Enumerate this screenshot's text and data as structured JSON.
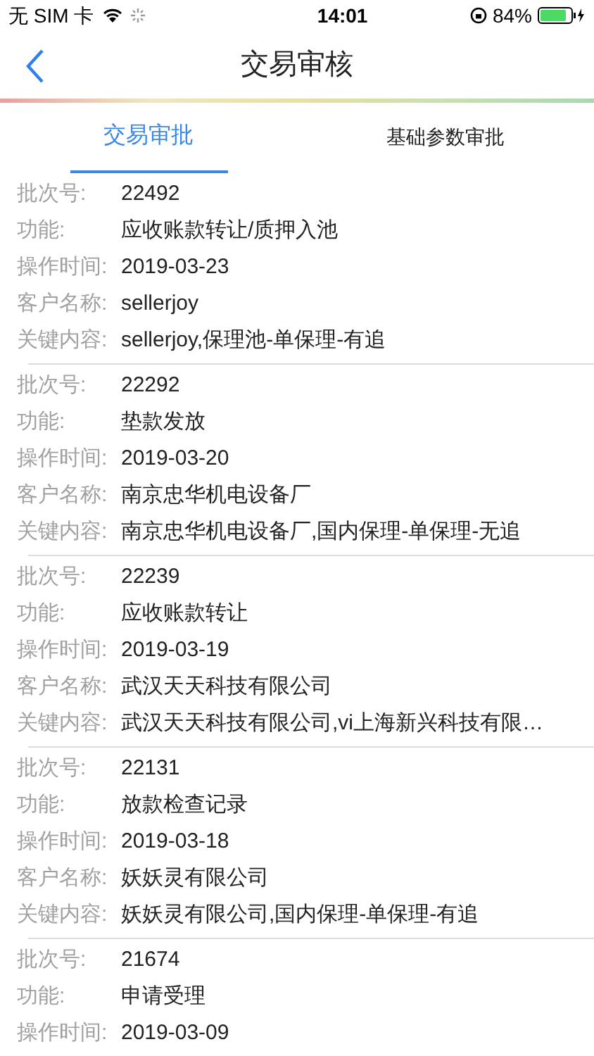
{
  "status_bar": {
    "carrier": "无 SIM 卡",
    "time": "14:01",
    "battery": "84%"
  },
  "nav": {
    "title": "交易审核"
  },
  "tabs": [
    {
      "label": "交易审批",
      "selected": true
    },
    {
      "label": "基础参数审批",
      "selected": false
    }
  ],
  "records": [
    {
      "fields": [
        {
          "label": "批次号:",
          "value": "22492"
        },
        {
          "label": "功能:",
          "value": "应收账款转让/质押入池"
        },
        {
          "label": "操作时间:",
          "value": "2019-03-23"
        },
        {
          "label": "客户名称:",
          "value": "sellerjoy"
        },
        {
          "label": "关键内容:",
          "value": "sellerjoy,保理池-单保理-有追"
        }
      ]
    },
    {
      "fields": [
        {
          "label": "批次号:",
          "value": "22292"
        },
        {
          "label": "功能:",
          "value": "垫款发放"
        },
        {
          "label": "操作时间:",
          "value": "2019-03-20"
        },
        {
          "label": "客户名称:",
          "value": "南京忠华机电设备厂"
        },
        {
          "label": "关键内容:",
          "value": "南京忠华机电设备厂,国内保理-单保理-无追"
        }
      ]
    },
    {
      "fields": [
        {
          "label": "批次号:",
          "value": "22239"
        },
        {
          "label": "功能:",
          "value": "应收账款转让"
        },
        {
          "label": "操作时间:",
          "value": "2019-03-19"
        },
        {
          "label": "客户名称:",
          "value": "武汉天天科技有限公司"
        },
        {
          "label": "关键内容:",
          "value": "武汉天天科技有限公司,vi上海新兴科技有限…"
        }
      ]
    },
    {
      "fields": [
        {
          "label": "批次号:",
          "value": "22131"
        },
        {
          "label": "功能:",
          "value": "放款检查记录"
        },
        {
          "label": "操作时间:",
          "value": "2019-03-18"
        },
        {
          "label": "客户名称:",
          "value": "妖妖灵有限公司"
        },
        {
          "label": "关键内容:",
          "value": "妖妖灵有限公司,国内保理-单保理-有追"
        }
      ]
    },
    {
      "fields": [
        {
          "label": "批次号:",
          "value": "21674"
        },
        {
          "label": "功能:",
          "value": "申请受理"
        },
        {
          "label": "操作时间:",
          "value": "2019-03-09"
        }
      ]
    }
  ]
}
